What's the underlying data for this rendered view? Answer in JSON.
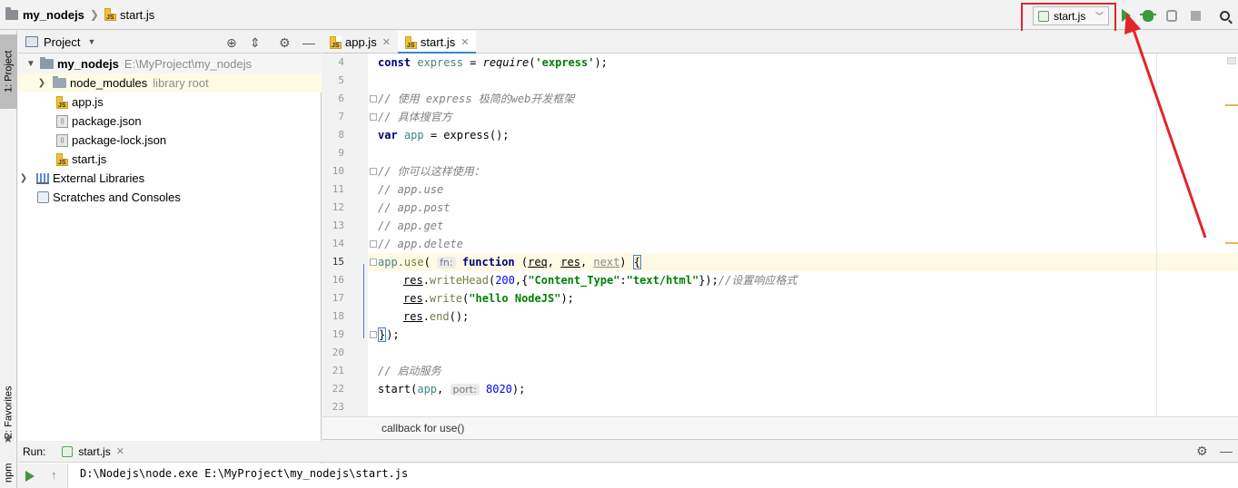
{
  "navbar": {
    "project": "my_nodejs",
    "file": "start.js"
  },
  "run_config": {
    "label": "start.js"
  },
  "toolstrip": {
    "project_tab": "1: Project",
    "favorites_tab": "2: Favorites",
    "npm_tab": "npm"
  },
  "project_panel": {
    "title": "Project",
    "tree": [
      {
        "label": "my_nodejs",
        "hint": "E:\\MyProject\\my_nodejs"
      },
      {
        "label": "node_modules",
        "hint": "library root"
      },
      {
        "label": "app.js"
      },
      {
        "label": "package.json"
      },
      {
        "label": "package-lock.json"
      },
      {
        "label": "start.js"
      },
      {
        "label": "External Libraries"
      },
      {
        "label": "Scratches and Consoles"
      }
    ]
  },
  "tabs": [
    {
      "label": "app.js",
      "active": false
    },
    {
      "label": "start.js",
      "active": true
    }
  ],
  "editor": {
    "line_numbers": [
      "4",
      "5",
      "6",
      "7",
      "8",
      "9",
      "10",
      "11",
      "12",
      "13",
      "14",
      "15",
      "16",
      "17",
      "18",
      "19",
      "20",
      "21",
      "22",
      "23"
    ],
    "current_line": "15",
    "code": {
      "l4": {
        "kw": "const",
        "name": " express",
        "eq": " = ",
        "call": "require",
        "arg": "'express'",
        "end": ");"
      },
      "l6": "// 使用 express 极简的web开发框架",
      "l7": "// 具体搜官方",
      "l8": {
        "kw": "var",
        "name": " app",
        "eq": " = ",
        "call": "express",
        "end": "();"
      },
      "l10": "// 你可以这样使用：",
      "l11": "// app.use",
      "l12": "// app.post",
      "l13": "// app.get",
      "l14": "// app.delete",
      "l15": {
        "pre": "app.",
        "meth": "use",
        "open": "(",
        "hint": "fn:",
        "kw": " function",
        "lp": " (",
        "p1": "req",
        "c1": ", ",
        "p2": "res",
        "c2": ", ",
        "p3": "next",
        "rp": ") ",
        "brace": "{"
      },
      "l16": {
        "obj": "res",
        "dot": ".",
        "meth": "writeHead",
        "open": "(",
        "num": "200",
        "mid": ",{",
        "k": "\"Content_Type\"",
        "colon": ":",
        "v": "\"text/html\"",
        "close": "});",
        "cm": "//设置响应格式"
      },
      "l17": {
        "obj": "res",
        "dot": ".",
        "meth": "write",
        "open": "(",
        "s": "\"hello NodeJS\"",
        "close": ");"
      },
      "l18": {
        "obj": "res",
        "dot": ".",
        "meth": "end",
        "close": "();"
      },
      "l19": {
        "brace": "}",
        "close": ");"
      },
      "l21": "// 启动服务",
      "l22": {
        "call": "start",
        "open": "(",
        "var": "app",
        "comma": ", ",
        "hint": "port:",
        "num": " 8020",
        "close": ");"
      }
    },
    "breadcrumb": "callback for use()"
  },
  "run_panel": {
    "title": "Run:",
    "tab": "start.js",
    "output": "D:\\Nodejs\\node.exe E:\\MyProject\\my_nodejs\\start.js"
  },
  "colors": {
    "accent": "#4083c9",
    "annotation": "#e0262a",
    "run_green": "#3c9a3c"
  }
}
